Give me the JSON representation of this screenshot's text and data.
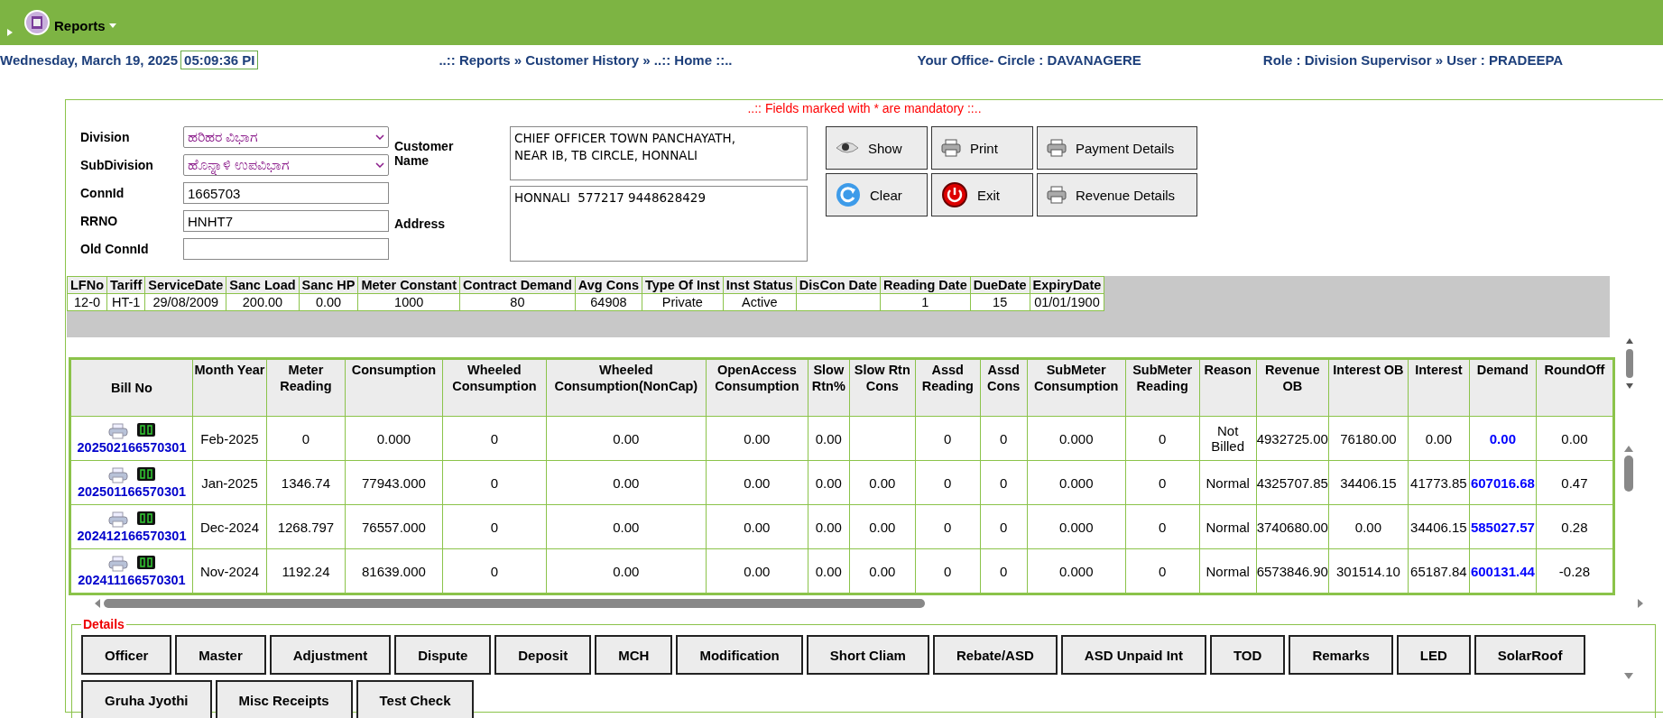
{
  "menu_bar": {
    "menu": "Reports"
  },
  "status_line": {
    "date": "Wednesday, March 19, 2025",
    "time": "05:09:36  PI",
    "breadcrumb": "..:: Reports » Customer History  »  ..:: Home ::..",
    "office": "Your Office- Circle : DAVANAGERE",
    "role": "Role : Division Supervisor »  User : PRADEEPA"
  },
  "form": {
    "notice": "..:: Fields marked with * are mandatory ::..",
    "fields": [
      {
        "label": "Division",
        "value": "ಹರಿಹರ ವಿಭಾಗ",
        "kind": "select"
      },
      {
        "label": "SubDivision",
        "value": "ಹೊನ್ನಾಳಿ ಉಪವಿಭಾಗ",
        "kind": "select"
      },
      {
        "label": "ConnId",
        "value": "1665703",
        "kind": "input"
      },
      {
        "label": "RRNO",
        "value": "HNHT7",
        "kind": "input"
      },
      {
        "label": "Old ConnId",
        "kind": "input"
      }
    ],
    "customer_name": {
      "label": "Customer Name",
      "value": "CHIEF OFFICER TOWN PANCHAYATH,\nNEAR IB, TB CIRCLE, HONNALI"
    },
    "address": {
      "label": "Address",
      "value": "HONNALI  577217 9448628429"
    },
    "buttons": [
      {
        "label": "Show",
        "kind": "eye"
      },
      {
        "label": "Print",
        "kind": "print"
      },
      {
        "label": "Payment Details",
        "kind": "print"
      },
      {
        "label": "Clear",
        "kind": "refresh"
      },
      {
        "label": "Exit",
        "kind": "power"
      },
      {
        "label": "Revenue Details",
        "kind": "print"
      }
    ]
  },
  "connection_table": {
    "columns": [
      "LFNo",
      "Tariff",
      "ServiceDate",
      "Sanc Load",
      "Sanc HP",
      "Meter Constant",
      "Contract Demand",
      "Avg Cons",
      "Type Of Inst",
      "Inst Status",
      "DisCon Date",
      "Reading Date",
      "DueDate",
      "ExpiryDate"
    ],
    "rows": [
      [
        "12-0",
        "HT-1",
        "29/08/2009",
        "200.00",
        "0.00",
        "1000",
        "80",
        "64908",
        "Private",
        "Active",
        "",
        "1",
        "15",
        "01/01/1900"
      ]
    ]
  },
  "bill_table": {
    "columns": [
      "Bill  No",
      "Month Year",
      "Meter Reading",
      "Consumption",
      "Wheeled Consumption",
      "Wheeled Consumption(NonCap)",
      "OpenAccess Consumption",
      "Slow Rtn%",
      "Slow Rtn Cons",
      "Assd Reading",
      "Assd Cons",
      "SubMeter Consumption",
      "SubMeter Reading",
      "Reason",
      "Revenue OB",
      "Interest OB",
      "Interest",
      "Demand",
      "RoundOff"
    ],
    "rows": [
      [
        "202502166570301",
        "Feb-2025",
        "0",
        "0.000",
        "0",
        "0.00",
        "0.00",
        "0.00",
        "",
        "0",
        "0",
        "0.000",
        "0",
        "Not Billed",
        "4932725.00",
        "76180.00",
        "0.00",
        "0.00",
        "0.00"
      ],
      [
        "202501166570301",
        "Jan-2025",
        "1346.74",
        "77943.000",
        "0",
        "0.00",
        "0.00",
        "0.00",
        "0.00",
        "0",
        "0",
        "0.000",
        "0",
        "Normal",
        "4325707.85",
        "34406.15",
        "41773.85",
        "607016.68",
        "0.47"
      ],
      [
        "202412166570301",
        "Dec-2024",
        "1268.797",
        "76557.000",
        "0",
        "0.00",
        "0.00",
        "0.00",
        "0.00",
        "0",
        "0",
        "0.000",
        "0",
        "Normal",
        "3740680.00",
        "0.00",
        "34406.15",
        "585027.57",
        "0.28"
      ],
      [
        "202411166570301",
        "Nov-2024",
        "1192.24",
        "81639.000",
        "0",
        "0.00",
        "0.00",
        "0.00",
        "0.00",
        "0",
        "0",
        "0.000",
        "0",
        "Normal",
        "6573846.90",
        "301514.10",
        "65187.84",
        "600131.44",
        "-0.28"
      ]
    ]
  },
  "details": {
    "legend": "Details",
    "buttons": [
      "Officer",
      "Master",
      "Adjustment",
      "Dispute",
      "Deposit",
      "MCH",
      "Modification",
      "Short Cliam",
      "Rebate/ASD",
      "ASD Unpaid Int",
      "TOD",
      "Remarks",
      "LED",
      "SolarRoof",
      "Gruha Jyothi",
      "Misc Receipts",
      "Test Check"
    ]
  }
}
